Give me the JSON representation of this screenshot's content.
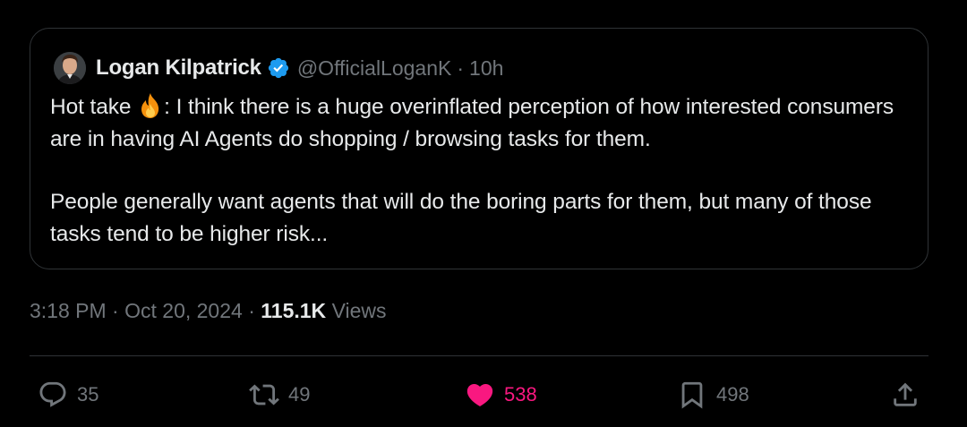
{
  "quoted_tweet": {
    "author": {
      "name": "Logan Kilpatrick",
      "handle": "@OfficialLoganK",
      "verified": true
    },
    "time_ago": "10h",
    "separator": "·",
    "text_parts": {
      "before_emoji": "Hot take ",
      "after_emoji": ": I think there is a huge overinflated perception of how interested consumers are in having AI Agents do shopping / browsing tasks for them.",
      "paragraph2": "People generally want agents that will do the boring parts for them, but many of those tasks tend to be higher risk..."
    },
    "emoji": "fire-icon"
  },
  "tweet_meta": {
    "time": "3:18 PM",
    "date": "Oct 20, 2024",
    "separator": "·",
    "views_count": "115.1K",
    "views_label": "Views"
  },
  "actions": {
    "reply": {
      "icon": "reply-icon",
      "count": "35"
    },
    "retweet": {
      "icon": "retweet-icon",
      "count": "49"
    },
    "like": {
      "icon": "heart-icon",
      "count": "538",
      "liked": true
    },
    "bookmark": {
      "icon": "bookmark-icon",
      "count": "498"
    },
    "share": {
      "icon": "share-icon"
    }
  },
  "colors": {
    "background": "#000000",
    "text_primary": "#e7e9ea",
    "text_secondary": "#71767b",
    "border": "#2f3336",
    "verified_blue": "#1d9bf0",
    "like_pink": "#f91880"
  }
}
